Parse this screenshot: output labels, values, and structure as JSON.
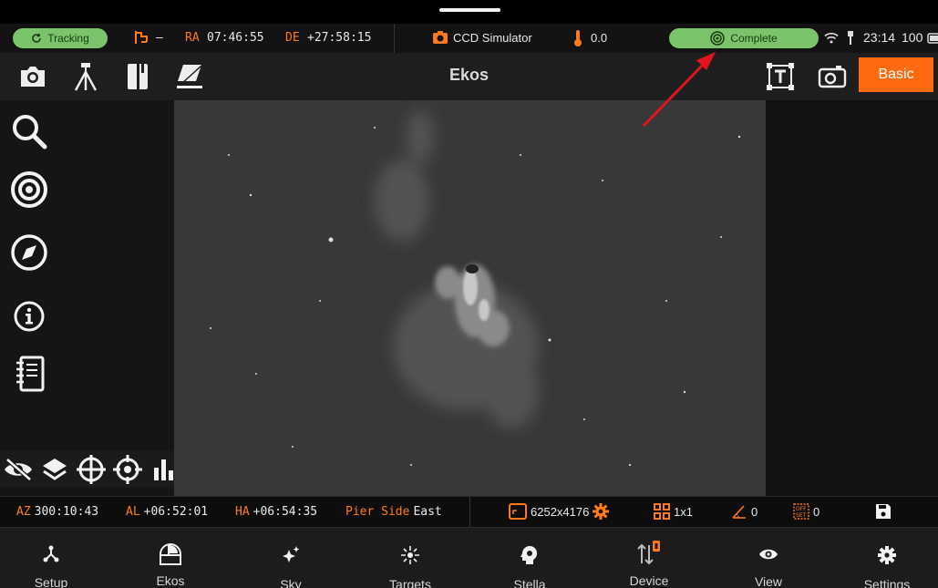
{
  "status": {
    "tracking_label": "Tracking",
    "mount_value": "–",
    "ra_label": "RA",
    "ra_value": "07:46:55",
    "de_label": "DE",
    "de_value": "+27:58:15",
    "camera_name": "CCD Simulator",
    "temperature": "0.0",
    "complete_label": "Complete",
    "time": "23:14",
    "battery": "100"
  },
  "toolbar": {
    "title": "Ekos",
    "basic_label": "Basic"
  },
  "info": {
    "az_label": "AZ",
    "az_value": "300:10:43",
    "al_label": "AL",
    "al_value": "+06:52:01",
    "ha_label": "HA",
    "ha_value": "+06:54:35",
    "pier_label": "Pier Side",
    "pier_value": "East",
    "resolution": "6252x4176",
    "binning": "1x1",
    "rotation_count": "0",
    "offset_count": "0"
  },
  "nav": [
    {
      "label": "Setup"
    },
    {
      "label": "Ekos"
    },
    {
      "label": "Sky"
    },
    {
      "label": "Targets"
    },
    {
      "label": "Stella"
    },
    {
      "label": "Device"
    },
    {
      "label": "View"
    },
    {
      "label": "Settings"
    }
  ],
  "colors": {
    "accent": "#ff6a10",
    "status_green": "#7cc46b",
    "annotation_arrow": "#e0141c"
  },
  "icons": {
    "toolbar_left": [
      "camera-icon",
      "tripod-icon",
      "notebook-icon",
      "polar-align-icon"
    ],
    "toolbar_right": [
      "text-frame-icon",
      "snapshot-icon"
    ],
    "sidebar": [
      "search-icon",
      "target-icon",
      "compass-icon",
      "info-icon",
      "logbook-icon"
    ],
    "overlay": [
      "hide-icon",
      "layers-icon",
      "crosshair-icon",
      "target-crosshair-icon",
      "histogram-icon"
    ]
  }
}
